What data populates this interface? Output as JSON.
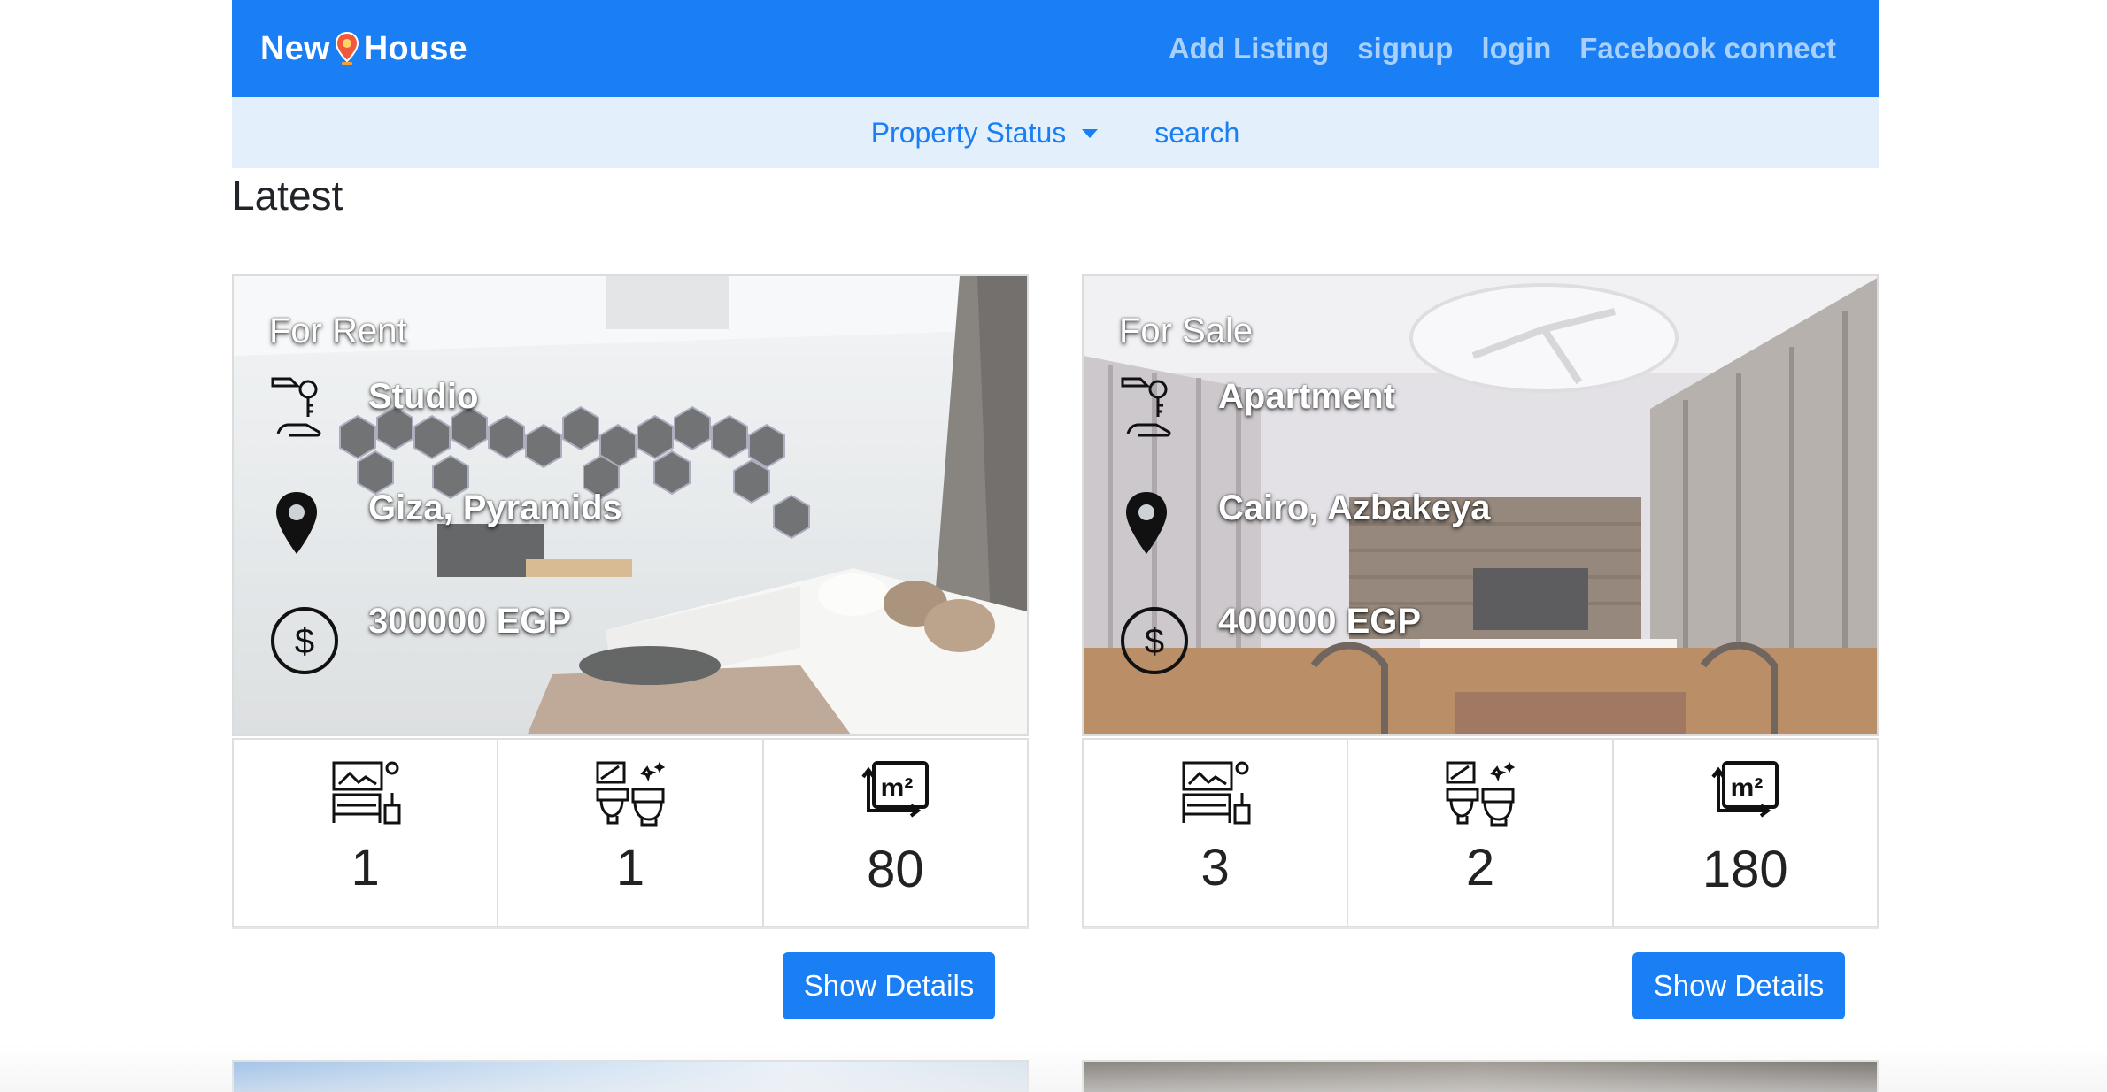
{
  "navbar": {
    "brand_left": "New",
    "brand_right": "House",
    "links": [
      "Add Listing",
      "signup",
      "login",
      "Facebook connect"
    ]
  },
  "subnav": {
    "property_status": "Property Status",
    "search": "search"
  },
  "section_title": "Latest",
  "listings": [
    {
      "status": "For Rent",
      "type": "Studio",
      "location": "Giza, Pyramids",
      "price": "300000 EGP",
      "bedrooms": "1",
      "bathrooms": "1",
      "area": "80",
      "button": "Show Details"
    },
    {
      "status": "For Sale",
      "type": "Apartment",
      "location": "Cairo, Azbakeya",
      "price": "400000 EGP",
      "bedrooms": "3",
      "bathrooms": "2",
      "area": "180",
      "button": "Show Details"
    }
  ],
  "icons": {
    "brand": "map-pin-icon",
    "type": "key-handover-icon",
    "location": "location-pin-icon",
    "price": "dollar-coin-icon",
    "bedrooms": "bedroom-icon",
    "bathrooms": "bathroom-icon",
    "area": "square-meter-icon"
  },
  "colors": {
    "primary": "#1a7ff4",
    "nav_link": "#a9d0fb",
    "subnav_bg": "#e3f0fc"
  }
}
